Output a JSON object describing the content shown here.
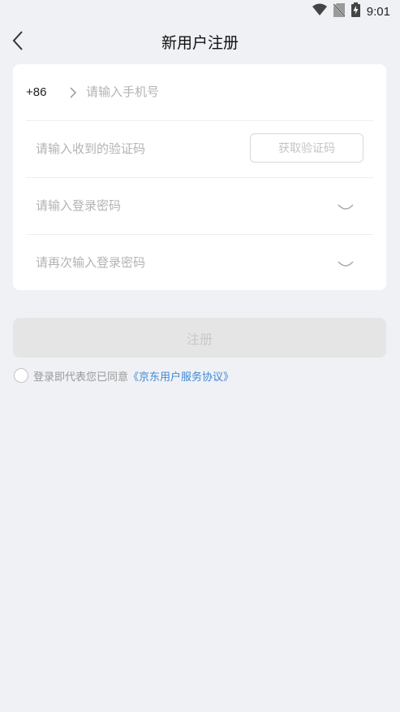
{
  "status_bar": {
    "time": "9:01",
    "icons": [
      "wifi-icon",
      "no-sim-icon",
      "battery-charging-icon"
    ]
  },
  "nav": {
    "back_icon": "chevron-left-icon",
    "title": "新用户注册"
  },
  "form": {
    "country_code": "+86",
    "phone_placeholder": "请输入手机号",
    "code_placeholder": "请输入收到的验证码",
    "get_code_label": "获取验证码",
    "password_placeholder": "请输入登录密码",
    "confirm_placeholder": "请再次输入登录密码"
  },
  "submit_label": "注册",
  "agreement": {
    "text": "登录即代表您已同意",
    "link": "《京东用户服务协议》"
  },
  "colors": {
    "background": "#f0f1f5",
    "link": "#3e88d8",
    "button_disabled": "#e5e5e5"
  }
}
